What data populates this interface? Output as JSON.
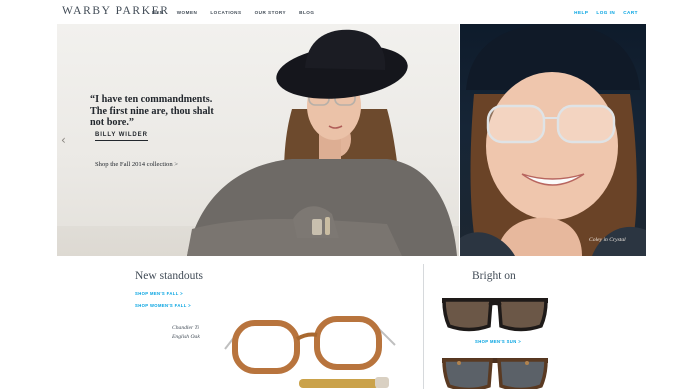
{
  "header": {
    "logo": "WARBY PARKER",
    "nav": [
      "MEN",
      "WOMEN",
      "LOCATIONS",
      "OUR STORY",
      "BLOG"
    ],
    "utility": [
      "HELP",
      "LOG IN",
      "CART"
    ],
    "accent_color": "#00a2e1"
  },
  "hero": {
    "quote": "“I have ten commandments. The first nine are, thou shalt not bore.”",
    "author": "BILLY WILDER",
    "cta": "Shop the Fall 2014 collection >",
    "prev_icon": "chevron-left-icon",
    "caption": "Coley in Crystal"
  },
  "new_standouts": {
    "title": "New standouts",
    "links": [
      "SHOP MEN'S FALL >",
      "SHOP WOMEN'S FALL >"
    ],
    "product_name": "Chandler Ti",
    "product_color": "English Oak"
  },
  "bright_on": {
    "title": "Bright on",
    "link": "SHOP MEN'S SUN >"
  }
}
